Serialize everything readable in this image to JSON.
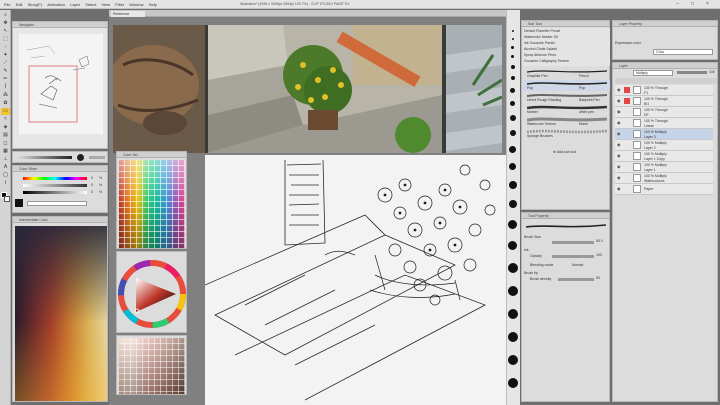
{
  "app": {
    "title": "Illustration* (4096 x 3096px 350dpi 100.7%) - CLIP STUDIO PAINT EX",
    "menu": [
      "File",
      "Edit",
      "Story(F)",
      "Animation",
      "Layer",
      "Select",
      "View",
      "Filter",
      "Window",
      "Help"
    ]
  },
  "navigator": {
    "title": "Navigator"
  },
  "reference": {
    "tab": "Reference"
  },
  "color_sets": {
    "title": "Color Set"
  },
  "color_slider": {
    "title": "Color Slider",
    "values": [
      "0",
      "0",
      "0"
    ],
    "unit": "%"
  },
  "intermediate": {
    "title": "Intermediate Color"
  },
  "brushes": {
    "title": "Sub Tool",
    "groups": [
      [
        "Default",
        "Planetlin",
        "Pencil"
      ],
      [
        "Watercolor",
        "Marker",
        "Oil"
      ],
      [
        "Ink",
        "Gouache",
        "Pastel"
      ],
      [
        "Alcohol",
        "Chalk",
        "Splash"
      ],
      [
        "Spray",
        "Airbrush",
        "Pens"
      ],
      [
        "Gouache",
        "Calligraphy",
        "Texture"
      ]
    ],
    "rows": [
      {
        "left": "Graphite Pen",
        "right": "Pencil"
      },
      {
        "left": "Pop",
        "right": "Pop"
      },
      {
        "left": "Ummi Rough Shading",
        "right": "Ballpoint Pen"
      },
      {
        "left": "Marker",
        "right": "white pen"
      },
      {
        "left": "Watercolor Texture",
        "right": "Noise"
      },
      {
        "left": "Sponge Brushes",
        "right": ""
      }
    ],
    "add_label": "Add sub tool"
  },
  "tool_property": {
    "title": "Tool Property",
    "rows": [
      {
        "label": "Brush Size",
        "value": "50.0"
      },
      {
        "label": "Ink",
        "value": ""
      },
      {
        "label": "Opacity",
        "value": "100"
      },
      {
        "label": "Blending mode",
        "value": "Normal"
      },
      {
        "label": "Brush tip",
        "value": ""
      },
      {
        "label": "Brush density",
        "value": "50"
      }
    ]
  },
  "layer_property": {
    "title": "Layer Property",
    "effect_label": "Expression color",
    "color_value": "Color"
  },
  "layers": {
    "title": "Layer",
    "blend_mode": "Multiply",
    "opacity": "100",
    "items": [
      {
        "line1": "100 % Through",
        "line2": "F1"
      },
      {
        "line1": "100 % Through",
        "line2": "BG"
      },
      {
        "line1": "100 % Through",
        "line2": "DF"
      },
      {
        "line1": "100 % Through",
        "line2": "Linear"
      },
      {
        "line1": "100 % Multiply",
        "line2": "Layer 3"
      },
      {
        "line1": "100 % Multiply",
        "line2": "Layer 2"
      },
      {
        "line1": "100 % Multiply",
        "line2": "Layer 1 Copy"
      },
      {
        "line1": "100 % Multiply",
        "line2": "Layer 1"
      },
      {
        "line1": "100 % Multiply",
        "line2": "Watercolours"
      },
      {
        "line1": "",
        "line2": "Paper"
      }
    ]
  }
}
